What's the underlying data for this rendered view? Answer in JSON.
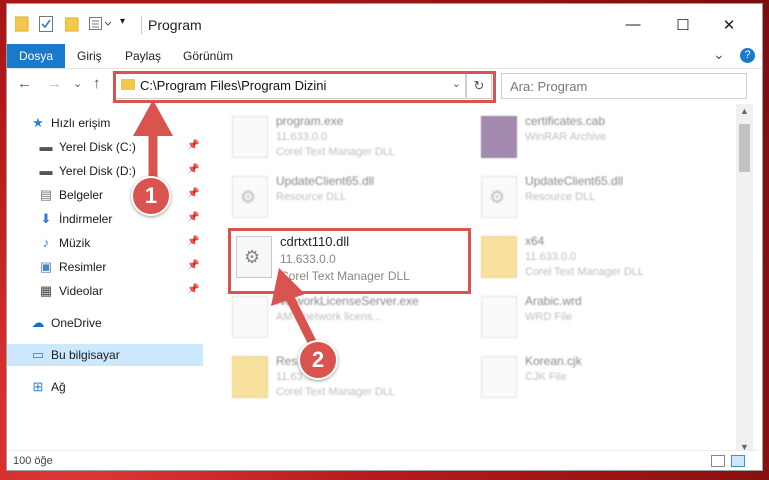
{
  "window": {
    "title": "Program",
    "minimize": "—",
    "maximize": "☐",
    "close": "✕"
  },
  "ribbon": {
    "tabs": [
      "Dosya",
      "Giriş",
      "Paylaş",
      "Görünüm"
    ],
    "expand": "⌄",
    "help": "?"
  },
  "nav": {
    "back": "←",
    "forward": "→",
    "recent": "⌄",
    "up": "↑",
    "address": "C:\\Program Files\\Program Dizini",
    "address_chevron": "⌄",
    "refresh": "↻",
    "search_placeholder": "Ara: Program"
  },
  "sidebar": {
    "items": [
      {
        "label": "Hızlı erişim",
        "icon": "star-icon"
      },
      {
        "label": "Yerel Disk (C:)",
        "icon": "drive-icon",
        "pinned": true
      },
      {
        "label": "Yerel Disk (D:)",
        "icon": "drive-icon",
        "pinned": true
      },
      {
        "label": "Belgeler",
        "icon": "documents-icon",
        "pinned": true
      },
      {
        "label": "İndirmeler",
        "icon": "download-icon",
        "pinned": true
      },
      {
        "label": "Müzik",
        "icon": "music-icon",
        "pinned": true
      },
      {
        "label": "Resimler",
        "icon": "pictures-icon",
        "pinned": true
      },
      {
        "label": "Videolar",
        "icon": "videos-icon",
        "pinned": true
      },
      {
        "label": "OneDrive",
        "icon": "cloud-icon"
      },
      {
        "label": "Bu bilgisayar",
        "icon": "computer-icon",
        "selected": true
      },
      {
        "label": "Ağ",
        "icon": "network-icon"
      }
    ]
  },
  "files": [
    {
      "name": "program.exe",
      "l2": "11.633.0.0",
      "l3": "Corel Text Manager DLL",
      "icon": "exe-icon"
    },
    {
      "name": "certificates.cab",
      "l2": "WinRAR Archive",
      "l3": "",
      "icon": "archive-icon"
    },
    {
      "name": "UpdateClient65.dll",
      "l2": "Resource DLL",
      "l3": "",
      "icon": "dll-icon"
    },
    {
      "name": "UpdateClient65.dll",
      "l2": "Resource DLL",
      "l3": "",
      "icon": "dll-icon"
    },
    {
      "name": "cdrtxt110.dll",
      "l2": "11.633.0.0",
      "l3": "Corel Text Manager DLL",
      "icon": "dll-icon"
    },
    {
      "name": "x64",
      "l2": "11.633.0.0",
      "l3": "Corel Text Manager DLL",
      "icon": "folder-icon"
    },
    {
      "name": "NetworkLicenseServer.exe",
      "l2": "AMY network licens...",
      "l3": "",
      "icon": "exe-icon"
    },
    {
      "name": "Arabic.wrd",
      "l2": "WRD File",
      "l3": "",
      "icon": "file-icon"
    },
    {
      "name": "Res...",
      "l2": "11.63...",
      "l3": "Corel Text Manager DLL",
      "icon": "folder-icon"
    },
    {
      "name": "Korean.cjk",
      "l2": "CJK File",
      "l3": "",
      "icon": "file-icon"
    }
  ],
  "status": {
    "count": "100 öğe"
  },
  "annotations": [
    "1",
    "2"
  ],
  "colors": {
    "accent": "#1979ca",
    "highlight": "#d9534f",
    "selected": "#cce8ff"
  }
}
